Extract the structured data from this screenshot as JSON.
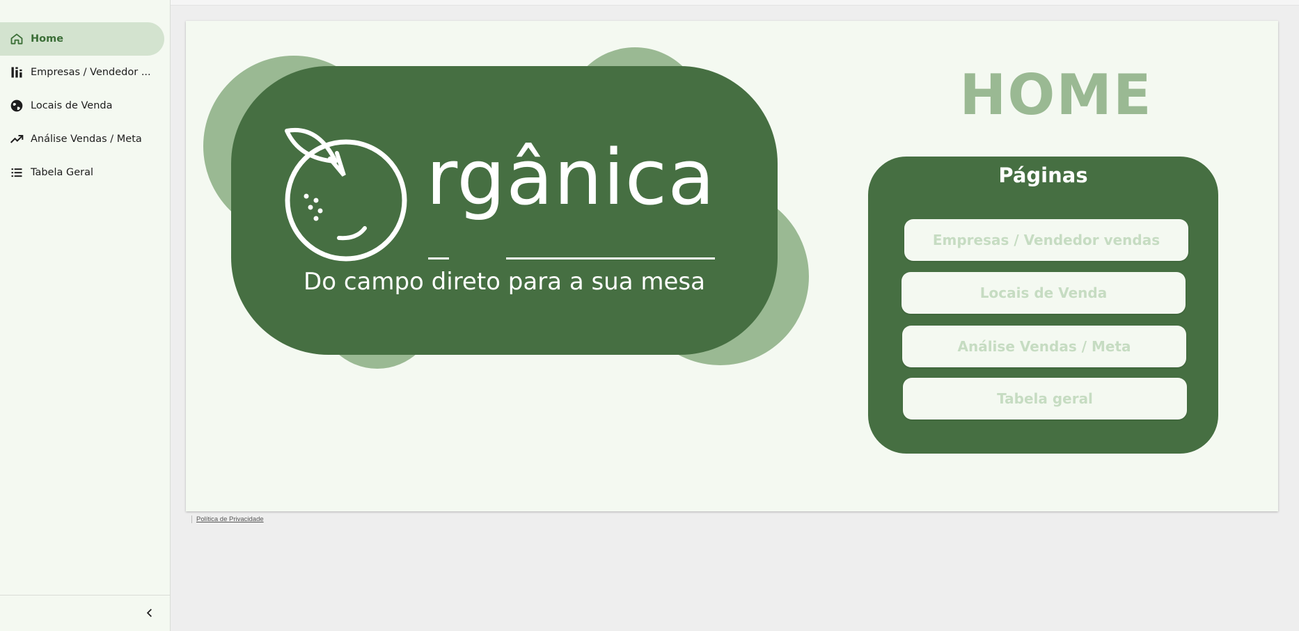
{
  "sidebar": {
    "items": [
      {
        "label": "Home",
        "icon": "home-icon",
        "active": true
      },
      {
        "label": "Empresas / Vendedor ...",
        "icon": "bar-chart-icon",
        "active": false
      },
      {
        "label": "Locais de Venda",
        "icon": "globe-icon",
        "active": false
      },
      {
        "label": "Análise Vendas / Meta",
        "icon": "trending-up-icon",
        "active": false
      },
      {
        "label": "Tabela Geral",
        "icon": "list-icon",
        "active": false
      }
    ],
    "collapse_icon": "chevron-left-icon"
  },
  "brand": {
    "initial_graphic": "orange-fruit-icon",
    "word": "rgânica",
    "tagline": "Do campo direto para a sua mesa"
  },
  "home_title": "HOME",
  "pages_panel": {
    "title": "Páginas",
    "buttons": [
      {
        "label": "Empresas / Vendedor vendas"
      },
      {
        "label": "Locais de Venda"
      },
      {
        "label": "Análise Vendas / Meta"
      },
      {
        "label": "Tabela geral"
      }
    ]
  },
  "footer": {
    "privacy_link": "Política de Privacidade"
  },
  "colors": {
    "dark_green": "#466f42",
    "light_green": "#9ab993",
    "background": "#f4f9f1",
    "button_text": "#c6dcc2",
    "active_nav": "#d3e3cf"
  }
}
